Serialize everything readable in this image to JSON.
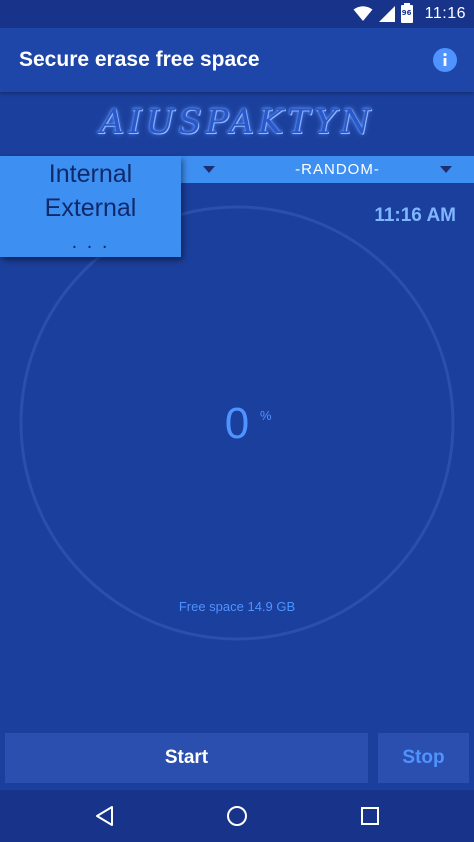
{
  "status_bar": {
    "time": "11:16",
    "battery_level": "96",
    "icons": [
      "wifi-icon",
      "signal-icon",
      "battery-icon"
    ]
  },
  "app_bar": {
    "title": "Secure erase free space",
    "info_icon": "info-icon"
  },
  "banner": {
    "text": "AIUSPAKTYN"
  },
  "storage_dropdown": {
    "options": [
      "Internal",
      "External",
      ". . ."
    ]
  },
  "method_spinner": {
    "value": "-RANDOM-"
  },
  "clock": {
    "time": "11:16 AM"
  },
  "progress": {
    "value": "0",
    "unit": "%",
    "fraction": 0
  },
  "free_space": {
    "label": "Free space 14.9 GB"
  },
  "actions": {
    "start_label": "Start",
    "stop_label": "Stop"
  },
  "nav_bar": {
    "buttons": [
      "back-icon",
      "home-icon",
      "recents-icon"
    ]
  },
  "colors": {
    "background": "#1b3f9c",
    "app_bar": "#1e46a8",
    "accent": "#3e8ff2",
    "text_accent": "#4f93ff"
  }
}
